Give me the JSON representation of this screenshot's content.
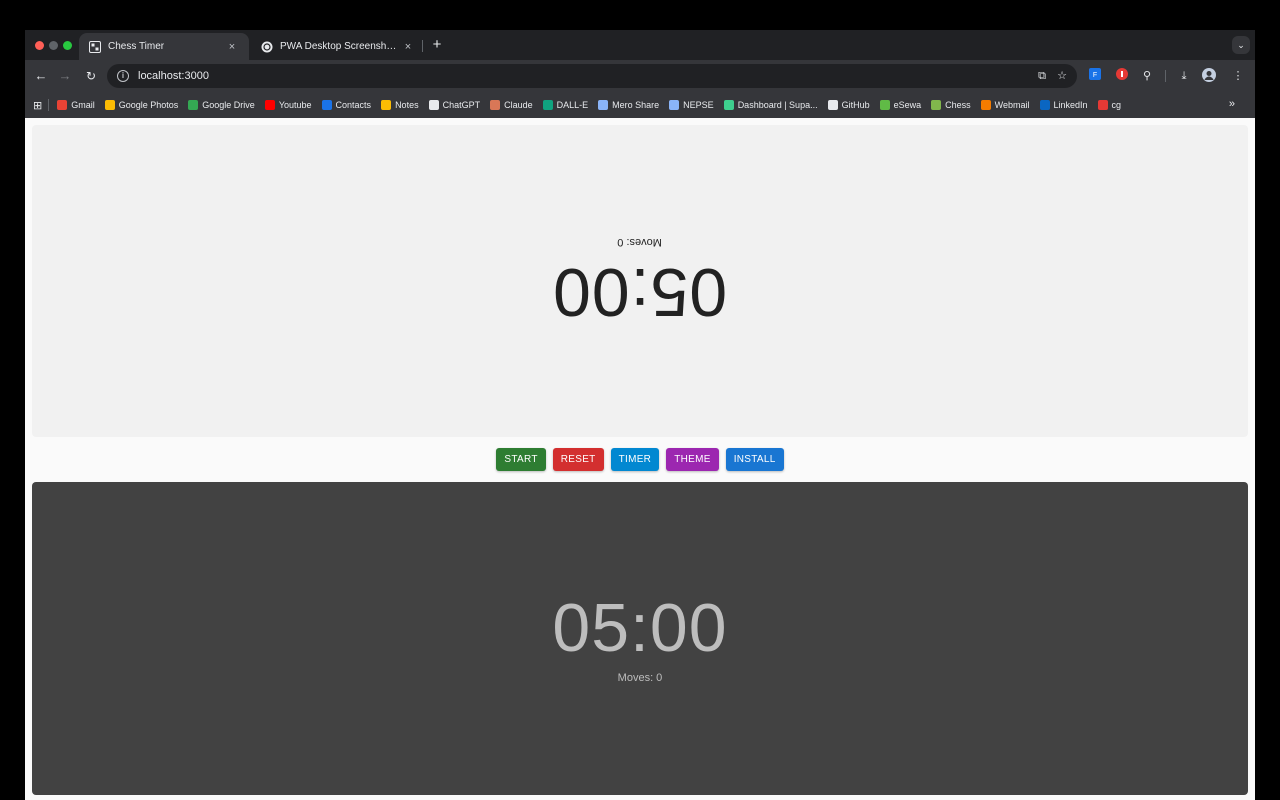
{
  "browser": {
    "tabs": [
      {
        "title": "Chess Timer",
        "active": true,
        "favicon": "chess-board-icon"
      },
      {
        "title": "PWA Desktop Screenshot Re",
        "active": false,
        "favicon": "chatgpt-icon"
      }
    ],
    "tab_close": "×",
    "new_tab": "+",
    "url": "localhost:3000",
    "bookmarks": [
      {
        "label": "Gmail",
        "icon": "gmail-icon",
        "color": "#ea4335"
      },
      {
        "label": "Google Photos",
        "icon": "google-photos-icon",
        "color": "#fbbc04"
      },
      {
        "label": "Google Drive",
        "icon": "google-drive-icon",
        "color": "#34a853"
      },
      {
        "label": "Youtube",
        "icon": "youtube-icon",
        "color": "#ff0000"
      },
      {
        "label": "Contacts",
        "icon": "contacts-icon",
        "color": "#1a73e8"
      },
      {
        "label": "Notes",
        "icon": "notes-icon",
        "color": "#fbbc04"
      },
      {
        "label": "ChatGPT",
        "icon": "chatgpt-icon",
        "color": "#e8eaed"
      },
      {
        "label": "Claude",
        "icon": "claude-icon",
        "color": "#d97757"
      },
      {
        "label": "DALL-E",
        "icon": "dalle-icon",
        "color": "#10a37f"
      },
      {
        "label": "Mero Share",
        "icon": "mero-share-icon",
        "color": "#8ab4f8"
      },
      {
        "label": "NEPSE",
        "icon": "nepse-icon",
        "color": "#8ab4f8"
      },
      {
        "label": "Dashboard | Supa...",
        "icon": "supabase-icon",
        "color": "#3ecf8e"
      },
      {
        "label": "GitHub",
        "icon": "github-icon",
        "color": "#e8eaed"
      },
      {
        "label": "eSewa",
        "icon": "esewa-icon",
        "color": "#60bb46"
      },
      {
        "label": "Chess",
        "icon": "chess-icon",
        "color": "#81b64c"
      },
      {
        "label": "Webmail",
        "icon": "webmail-icon",
        "color": "#f57c00"
      },
      {
        "label": "LinkedIn",
        "icon": "linkedin-icon",
        "color": "#0a66c2"
      },
      {
        "label": "cg",
        "icon": "cg-icon",
        "color": "#e53935"
      }
    ],
    "bookmarks_more": "»"
  },
  "app": {
    "top_player": {
      "time": "05:00",
      "moves": "Moves: 0"
    },
    "bottom_player": {
      "time": "05:00",
      "moves": "Moves: 0"
    },
    "controls": [
      {
        "label": "START",
        "color": "#2e7d32"
      },
      {
        "label": "RESET",
        "color": "#d32f2f"
      },
      {
        "label": "TIMER",
        "color": "#0288d1"
      },
      {
        "label": "THEME",
        "color": "#9c27b0"
      },
      {
        "label": "INSTALL",
        "color": "#1976d2"
      }
    ]
  }
}
